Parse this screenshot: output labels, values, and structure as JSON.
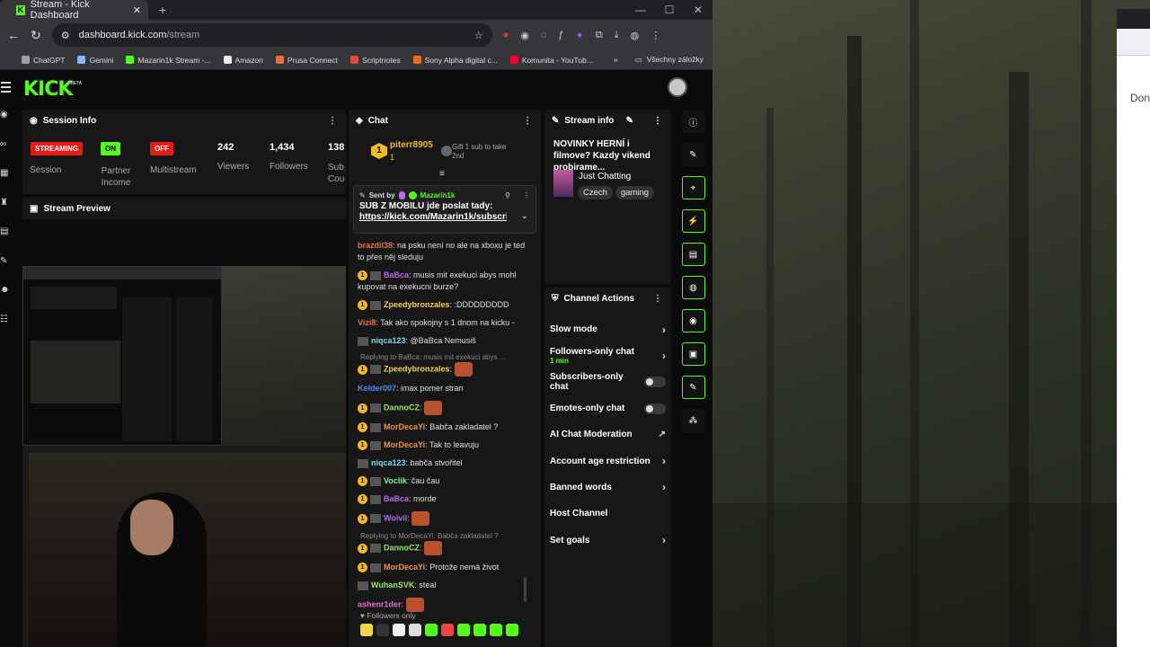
{
  "browser": {
    "tab_title": "Stream - Kick Dashboard",
    "url_host": "dashboard.kick.com",
    "url_path": "/stream",
    "bookmarks": [
      {
        "label": "ChatGPT",
        "color": "#9aa0a6"
      },
      {
        "label": "Gemini",
        "color": "#8ab4f8"
      },
      {
        "label": "Mazarin1k Stream -...",
        "color": "#53fc18"
      },
      {
        "label": "Amazon",
        "color": "#eeeeee"
      },
      {
        "label": "Prusa Connect",
        "color": "#fa6831"
      },
      {
        "label": "Scriptnotes",
        "color": "#e04a3a"
      },
      {
        "label": "Sony Alpha digital c...",
        "color": "#f26b1d"
      },
      {
        "label": "Komunita - YouTub...",
        "color": "#ff0033"
      }
    ],
    "all_bookmarks": "Všechny záložky"
  },
  "kick": {
    "logo": "KICK",
    "beta": "BETA"
  },
  "session": {
    "title": "Session Info",
    "items": [
      {
        "badge": "STREAMING",
        "label": "Session",
        "color": "#e91916"
      },
      {
        "badge": "ON",
        "label": "Partner Income",
        "color": "#53fc18"
      },
      {
        "badge": "OFF",
        "label": "Multistream",
        "color": "#e91916"
      }
    ],
    "stats": [
      {
        "value": "242",
        "label": "Viewers"
      },
      {
        "value": "1,434",
        "label": "Followers"
      },
      {
        "value": "138",
        "label": "Sub Cou"
      }
    ]
  },
  "preview": {
    "title": "Stream Preview"
  },
  "chat": {
    "title": "Chat",
    "top_gifter": {
      "rank": "1",
      "name": "piterr8905",
      "count": "1",
      "gift_text": "Gift 1 sub to take 2nd"
    },
    "pinned": {
      "sent_by_label": "Sent by",
      "sender": "Mazarin1k",
      "line1": "SUB Z MOBILU jde poslat tady:",
      "line2": "https://kick.com/Mazarin1k/subscri..."
    },
    "messages": [
      {
        "user": "brazdil38",
        "color": "#e8734a",
        "text": "na psku není no ale na xboxu je ted to přes něj sleduju",
        "sub": false,
        "reply": ""
      },
      {
        "user": "BaBca",
        "color": "#b36cf0",
        "text": "musis mit exekuci abys mohl kupovat na exekucni burze?",
        "sub": true,
        "reply": ""
      },
      {
        "user": "Zpeedybronzales",
        "color": "#f3d44a",
        "text": ":DDDDDDDDD",
        "sub": true,
        "reply": ""
      },
      {
        "user": "Vizi8",
        "color": "#e8734a",
        "text": "Tak ako spokojny s 1 dnom na kicku -",
        "sub": false,
        "reply": ""
      },
      {
        "user": "niqca123",
        "color": "#7fd6f0",
        "text": "@BaBca Nemusiš",
        "sub": false,
        "reply": ""
      },
      {
        "user": "Zpeedybronzales",
        "color": "#f3d44a",
        "text": "",
        "sub": true,
        "reply": "Replying to BaBca: musis mit exekuci abys ..."
      },
      {
        "user": "Kelder007",
        "color": "#4a8cf0",
        "text": "imax pomer stran",
        "sub": false,
        "reply": ""
      },
      {
        "user": "DannoCZ",
        "color": "#9be36a",
        "text": "",
        "sub": true,
        "reply": ""
      },
      {
        "user": "MorDecaYi",
        "color": "#f0934a",
        "text": "Babča zakladatel ?",
        "sub": true,
        "reply": ""
      },
      {
        "user": "MorDecaYi",
        "color": "#f0934a",
        "text": "Tak to leavuju",
        "sub": true,
        "reply": ""
      },
      {
        "user": "niqca123",
        "color": "#7fd6f0",
        "text": "babča stvořitel",
        "sub": false,
        "reply": ""
      },
      {
        "user": "Voclik",
        "color": "#7ff0a8",
        "text": "čau čau",
        "sub": true,
        "reply": ""
      },
      {
        "user": "BaBca",
        "color": "#b36cf0",
        "text": "morde",
        "sub": true,
        "reply": ""
      },
      {
        "user": "Woivii",
        "color": "#b36cf0",
        "text": "",
        "sub": true,
        "reply": ""
      },
      {
        "user": "DannoCZ",
        "color": "#9be36a",
        "text": "",
        "sub": true,
        "reply": "Replying to MorDecaYi: Babča zakladatel ?"
      },
      {
        "user": "MorDecaYi",
        "color": "#f0934a",
        "text": "Protože nemá život",
        "sub": true,
        "reply": ""
      },
      {
        "user": "WuhanSVK",
        "color": "#9be36a",
        "text": "steal",
        "sub": false,
        "reply": ""
      },
      {
        "user": "ashenr1der",
        "color": "#e86bd0",
        "text": "",
        "sub": false,
        "reply": ""
      }
    ],
    "followers_only": "Followers only"
  },
  "stream_info": {
    "title": "Stream info",
    "stream_title": "NOVINKY HERNÍ i filmove? Kazdy vikend probirame...",
    "category": "Just Chatting",
    "tags": [
      "Czech",
      "gaming"
    ]
  },
  "channel_actions": {
    "title": "Channel Actions",
    "items": [
      {
        "label": "Slow mode",
        "sub": "",
        "control": "chevron"
      },
      {
        "label": "Followers-only chat",
        "sub": "1 min",
        "control": "chevron"
      },
      {
        "label": "Subscribers-only chat",
        "sub": "",
        "control": "toggle"
      },
      {
        "label": "Emotes-only chat",
        "sub": "",
        "control": "toggle"
      },
      {
        "label": "AI Chat Moderation",
        "sub": "",
        "control": "external"
      },
      {
        "label": "Account age restriction",
        "sub": "",
        "control": "chevron"
      },
      {
        "label": "Banned words",
        "sub": "",
        "control": "chevron"
      },
      {
        "label": "Host Channel",
        "sub": "",
        "control": "none"
      },
      {
        "label": "Set goals",
        "sub": "",
        "control": "chevron"
      }
    ]
  },
  "right_rail": [
    "info-icon",
    "pencil-icon",
    "scan-icon",
    "lightning-icon",
    "document-icon",
    "chat-bubble-icon",
    "broadcast-icon",
    "layout-icon",
    "wrench-icon",
    "nodes-icon"
  ],
  "second_window": {
    "text": "Don"
  },
  "colors": {
    "accent": "#53fc18",
    "bg": "#0b0b0b",
    "panel": "#171717",
    "live": "#e91916"
  }
}
